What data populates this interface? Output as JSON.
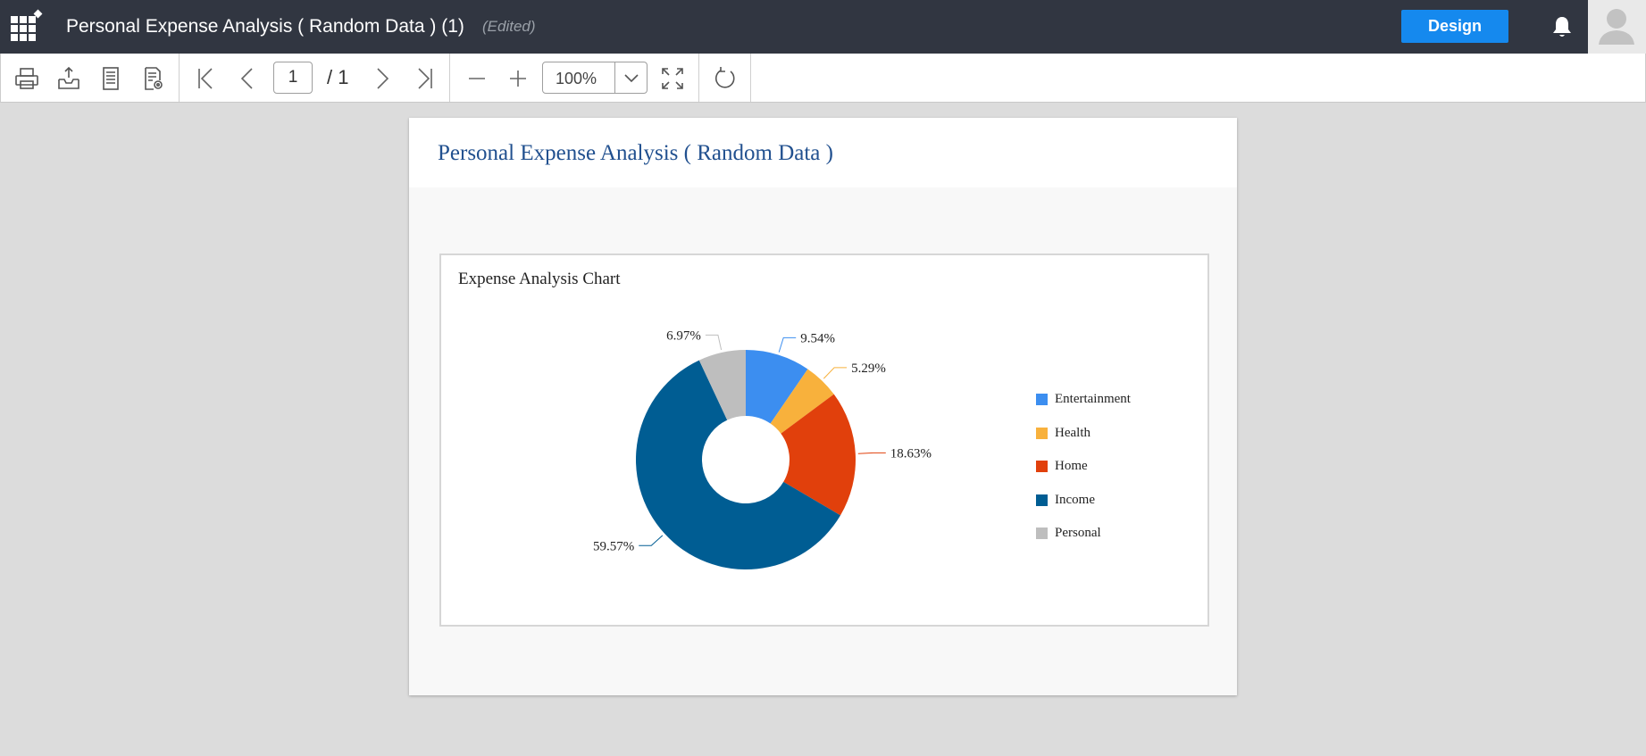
{
  "app": {
    "document_title": "Personal Expense Analysis ( Random Data ) (1)",
    "status": "(Edited)",
    "design_button": "Design"
  },
  "toolbar": {
    "current_page": "1",
    "total_pages": "/ 1",
    "zoom": "100%"
  },
  "report": {
    "title": "Personal Expense Analysis ( Random Data )"
  },
  "chart_data": {
    "type": "pie",
    "title": "Expense Analysis Chart",
    "donut": true,
    "legend_position": "right",
    "categories": [
      "Entertainment",
      "Health",
      "Home",
      "Income",
      "Personal"
    ],
    "values": [
      9.54,
      5.29,
      18.63,
      59.57,
      6.97
    ],
    "labels": [
      "9.54%",
      "5.29%",
      "18.63%",
      "59.57%",
      "6.97%"
    ],
    "colors": [
      "#3c8ef0",
      "#f8b13c",
      "#e1400c",
      "#005d93",
      "#bebebe"
    ]
  }
}
